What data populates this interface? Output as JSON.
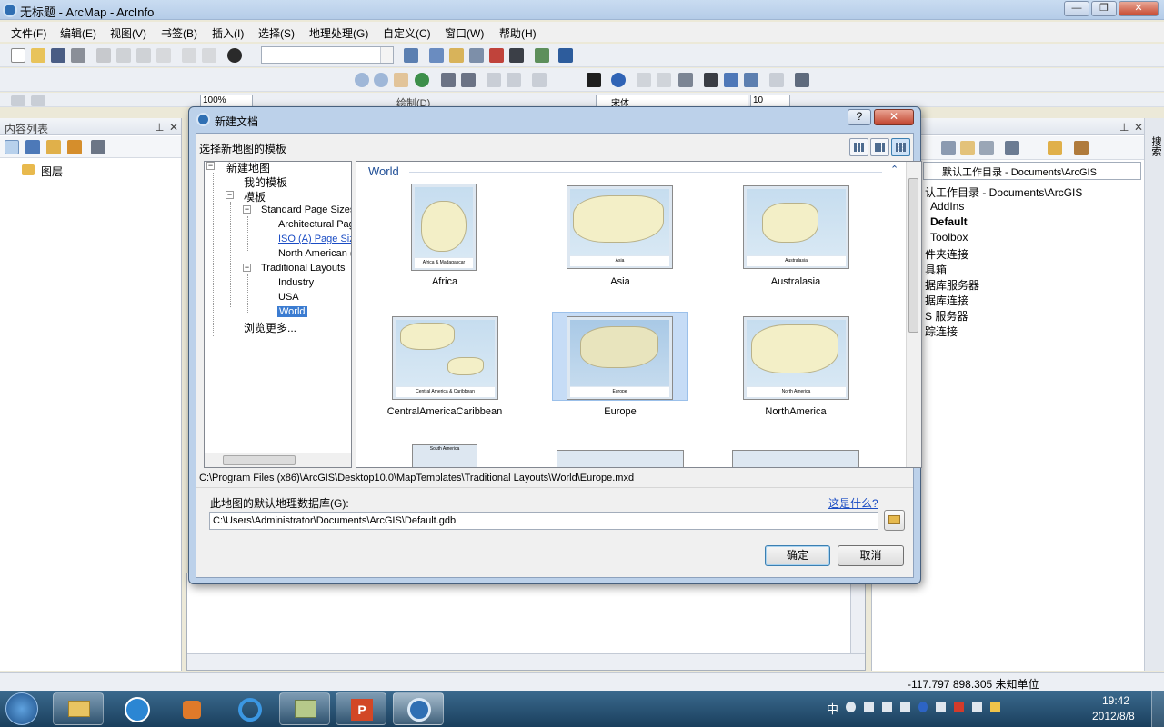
{
  "window": {
    "title": "无标题 - ArcMap - ArcInfo"
  },
  "menu": [
    "文件(F)",
    "编辑(E)",
    "视图(V)",
    "书签(B)",
    "插入(I)",
    "选择(S)",
    "地理处理(G)",
    "自定义(C)",
    "窗口(W)",
    "帮助(H)"
  ],
  "toolbar3": {
    "zoom": "100%",
    "draw": "绘制(D)",
    "font": "宋体",
    "size": "10"
  },
  "toc": {
    "title": "内容列表",
    "layers": "图层"
  },
  "catalog": {
    "location": "默认工作目录 - Documents\\ArcGIS",
    "items": [
      "认工作目录 - Documents\\ArcGIS",
      "AddIns",
      "Default",
      "Toolbox",
      "件夹连接",
      "具箱",
      "据库服务器",
      "据库连接",
      "S 服务器",
      "踪连接"
    ],
    "side": "搜索"
  },
  "dialog": {
    "title": "新建文档",
    "subtitle": "选择新地图的模板",
    "tree": {
      "root": "新建地图",
      "my": "我的模板",
      "templates": "模板",
      "standard": "Standard Page Sizes",
      "arch": "Architectural Pag",
      "iso": "ISO (A) Page Siz",
      "na": "North American (",
      "traditional": "Traditional Layouts",
      "industry": "Industry",
      "usa": "USA",
      "world": "World",
      "browse": "浏览更多..."
    },
    "gallery": {
      "group": "World",
      "items": [
        "Africa",
        "Asia",
        "Australasia",
        "CentralAmericaCaribbean",
        "Europe",
        "NorthAmerica"
      ],
      "captions": [
        "Africa & Madagascar",
        "Asia",
        "Australasia",
        "Central America & Caribbean",
        "Europe",
        "North America",
        "South America"
      ]
    },
    "path": "C:\\Program Files (x86)\\ArcGIS\\Desktop10.0\\MapTemplates\\Traditional Layouts\\World\\Europe.mxd",
    "gdb_label": "此地图的默认地理数据库(G):",
    "whatis": "这是什么?",
    "gdb_value": "C:\\Users\\Administrator\\Documents\\ArcGIS\\Default.gdb",
    "ok": "确定",
    "cancel": "取消"
  },
  "status": {
    "coords": "-117.797  898.305 未知单位"
  },
  "tray": {
    "time": "19:42",
    "date": "2012/8/8",
    "ime": "中"
  }
}
